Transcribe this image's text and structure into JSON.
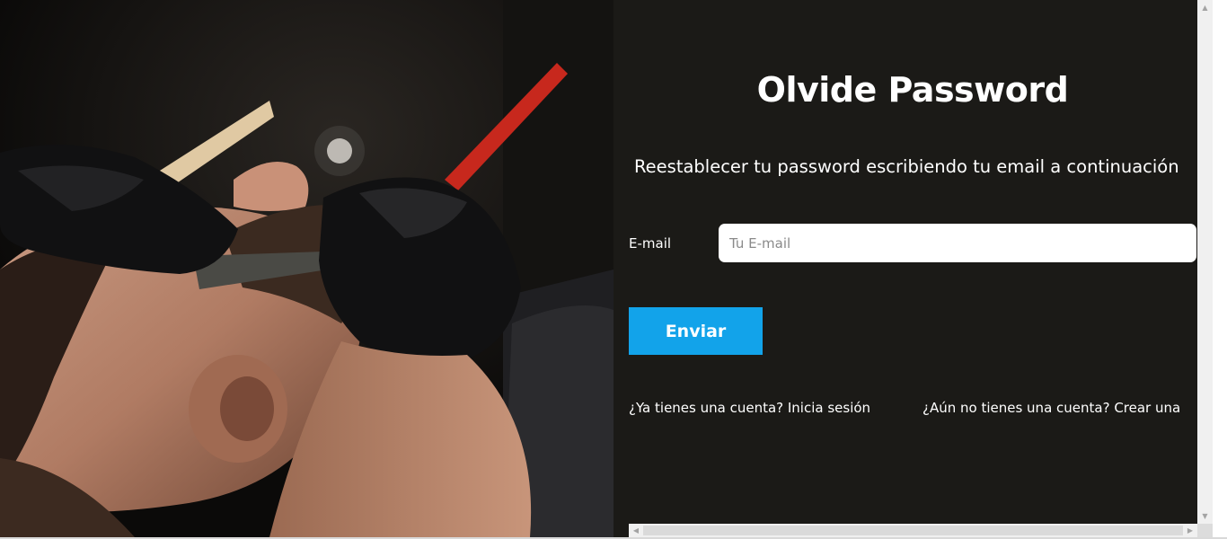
{
  "form": {
    "title": "Olvide Password",
    "subtitle": "Reestablecer tu password escribiendo tu email a continuación",
    "email_label": "E-mail",
    "email_placeholder": "Tu E-mail",
    "email_value": "",
    "submit_label": "Enviar"
  },
  "links": {
    "login": "¿Ya tienes una cuenta? Inicia sesión",
    "register": "¿Aún no tienes una cuenta? Crear una"
  },
  "scrollbars": {
    "up_arrow": "▲",
    "down_arrow": "▼",
    "left_arrow": "◀",
    "right_arrow": "▶"
  },
  "colors": {
    "panel_bg": "#1b1a17",
    "button_bg": "#12a3ea",
    "text": "#ffffff"
  },
  "hero_image": {
    "icon": "barber-shaving-photo"
  }
}
